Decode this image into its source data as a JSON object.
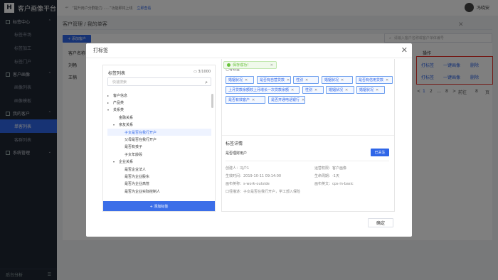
{
  "app": {
    "title": "客户画像平台",
    "logo_mark": "H"
  },
  "sidebar": {
    "groups": [
      {
        "label": "标签中心",
        "items": [
          "标签市场",
          "标签加工",
          "标签门户"
        ]
      },
      {
        "label": "客户画像",
        "items": [
          "画像列表",
          "画像模板"
        ]
      },
      {
        "label": "我的客户",
        "items": [
          "单客列表",
          "客群列表"
        ]
      },
      {
        "label": "系统管理",
        "items": []
      }
    ],
    "footer_label": "后台分析"
  },
  "topbar": {
    "notice": "“提升用户分群能力……”功能即将上线",
    "notice_link": "立即查看",
    "user": "冯晓安"
  },
  "breadcrumb": "客户管理 / 我的单客",
  "toolbar": {
    "add_label": "+ 添加客户",
    "search_placeholder": "请输入客户名称或客户单体编号"
  },
  "table": {
    "headers": [
      "客户名称",
      "操作"
    ],
    "rows": [
      {
        "name": "刘畅",
        "ops": [
          "打标签",
          "一键画像",
          "删除"
        ]
      },
      {
        "name": "王楠",
        "ops": [
          "打标签",
          "一键画像",
          "删除"
        ]
      }
    ]
  },
  "pager": {
    "prev": "<",
    "pages": [
      "1",
      "2",
      "…",
      "8"
    ],
    "next": ">",
    "goto": "前往",
    "goto_page": "8",
    "unit": "页"
  },
  "modal": {
    "title": "打标签",
    "left": {
      "title": "标签列表",
      "count": "3/1000",
      "search_placeholder": "快速搜索",
      "tree": [
        {
          "label": "客户信息",
          "caret": "▸",
          "level": 0,
          "selected": false
        },
        {
          "label": "产品类",
          "caret": "▸",
          "level": 0,
          "selected": false
        },
        {
          "label": "关系类",
          "caret": "▾",
          "level": 0,
          "selected": false
        },
        {
          "label": "金融关系",
          "caret": "",
          "level": 1,
          "selected": false
        },
        {
          "label": "亲友关系",
          "caret": "▾",
          "level": 1,
          "selected": false
        },
        {
          "label": "子女是否在我行开户",
          "caret": "",
          "level": 2,
          "selected": true
        },
        {
          "label": "父母是否在我行开户",
          "caret": "",
          "level": 2,
          "selected": false
        },
        {
          "label": "是否有孩子",
          "caret": "",
          "level": 2,
          "selected": false
        },
        {
          "label": "子女年龄段",
          "caret": "",
          "level": 2,
          "selected": false
        },
        {
          "label": "企业关系",
          "caret": "▾",
          "level": 1,
          "selected": false
        },
        {
          "label": "是否企业法人",
          "caret": "",
          "level": 2,
          "selected": false
        },
        {
          "label": "是否为企业股东",
          "caret": "",
          "level": 2,
          "selected": false
        },
        {
          "label": "是否为企业高管",
          "caret": "",
          "level": 2,
          "selected": false
        },
        {
          "label": "是否为企业实际控制人",
          "caret": "",
          "level": 2,
          "selected": false
        }
      ],
      "add_button": "+ 添加标签"
    },
    "right": {
      "toast": "保存成功！",
      "subtitle": "已有标签",
      "tags": [
        "婚姻状况",
        "是否有自营贷款",
        "性别",
        "婚姻状况",
        "是否有信用贷款",
        "上月贷款余额较上月增长一次贷款余额",
        "性别",
        "婚姻状况",
        "婚姻状况",
        "是否有效客户",
        "是否开通电话银行"
      ],
      "detail_title": "标签详情",
      "detail_name": "是否理财用户",
      "follow_button": "已关注",
      "info": [
        "创建人：冯户1",
        "生效时间：2019-10-11 09:14:00",
        "画布英称：s-work-outside",
        "口径描述：子女是否在我行开户，学工部入保险",
        "运营权限：客户画像",
        "生命周期：-1天",
        "画布英文：cps-in-basic"
      ]
    },
    "confirm": "确定"
  },
  "colors": {
    "primary": "#2f66e8",
    "sidebar_bg": "#1f2633",
    "highlight_box": "#e8332a",
    "success": "#67c23a"
  }
}
